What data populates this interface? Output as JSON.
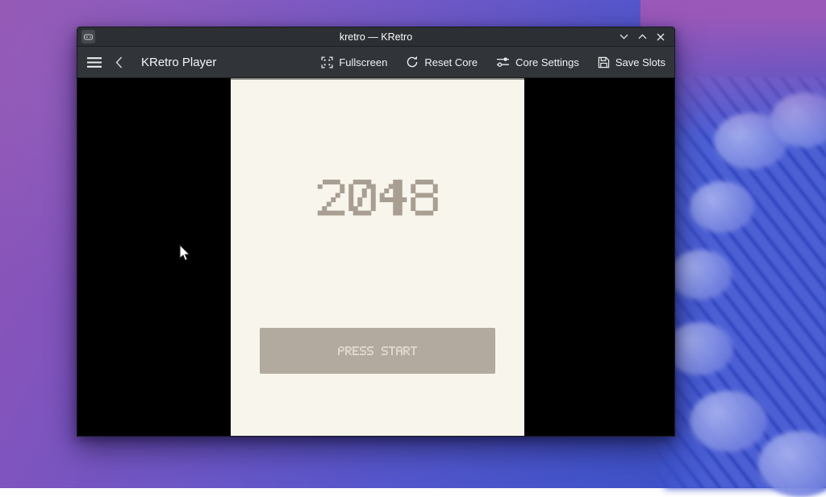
{
  "wallpaper": {
    "base_left_color": "#9355b4",
    "base_right_color": "#3b4fc5",
    "ribbon_color": "#7c8ae2"
  },
  "window": {
    "titlebar": {
      "title": "kretro — KRetro"
    },
    "toolbar": {
      "app_title": "KRetro Player",
      "buttons": [
        {
          "label": "Fullscreen",
          "icon": "fullscreen-icon"
        },
        {
          "label": "Reset Core",
          "icon": "reset-icon"
        },
        {
          "label": "Core Settings",
          "icon": "settings-sliders-icon"
        },
        {
          "label": "Save Slots",
          "icon": "save-icon"
        }
      ]
    },
    "game": {
      "title_text": "2048",
      "press_start_label": "PRESS START",
      "screen_bg": "#f8f5ec",
      "pixel_text_color": "#a89e92",
      "button_bg": "#b2aa9f",
      "button_text_color": "#ded6c8"
    }
  }
}
